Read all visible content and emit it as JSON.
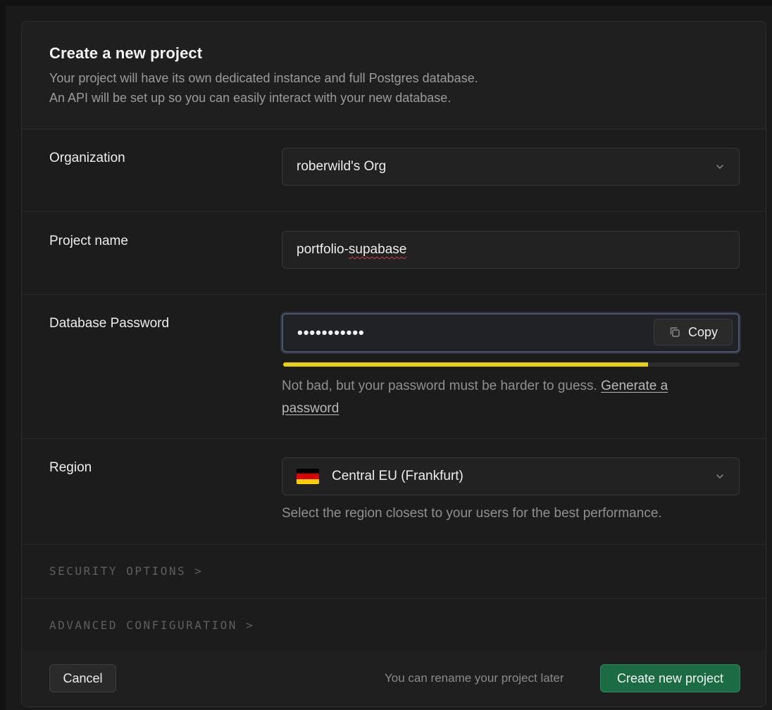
{
  "dialog": {
    "title": "Create a new project",
    "subtitle_line1": "Your project will have its own dedicated instance and full Postgres database.",
    "subtitle_line2": "An API will be set up so you can easily interact with your new database."
  },
  "organization": {
    "label": "Organization",
    "value": "roberwild's Org",
    "icon": "chevron-down-icon"
  },
  "project_name": {
    "label": "Project name",
    "value": "portfolio-supabase"
  },
  "database_password": {
    "label": "Database Password",
    "masked_value": "•••••••••••",
    "copy_label": "Copy",
    "strength_fraction": 0.8,
    "strength_color": "#e8cf10",
    "hint": "Not bad, but your password must be harder to guess.",
    "generate_link_line1": "Generate a",
    "generate_link_line2": "password"
  },
  "region": {
    "label": "Region",
    "value": "Central EU (Frankfurt)",
    "flag_colors": [
      "#000000",
      "#dd0000",
      "#ffce00"
    ],
    "hint": "Select the region closest to your users for the best performance."
  },
  "sections": {
    "security": "SECURITY OPTIONS",
    "advanced": "ADVANCED CONFIGURATION",
    "chevron": ">"
  },
  "footer": {
    "cancel_label": "Cancel",
    "note": "You can rename your project later",
    "create_label": "Create new project",
    "create_color": "#1b6b45"
  }
}
